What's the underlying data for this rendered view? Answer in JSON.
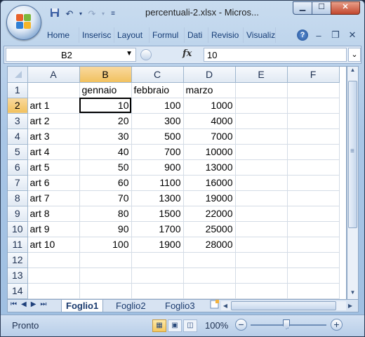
{
  "window": {
    "title": "percentuali-2.xlsx - Micros..."
  },
  "qat": {
    "save_icon": "save-icon",
    "undo_icon": "undo-icon",
    "redo_icon": "redo-icon",
    "customize_icon": "chevron-down-icon"
  },
  "ribbon": {
    "tabs": [
      "Home",
      "Inserisc",
      "Layout",
      "Formul",
      "Dati",
      "Revisio",
      "Visualiz"
    ]
  },
  "formula_bar": {
    "cell_ref": "B2",
    "fx_label": "fx",
    "content": "10"
  },
  "grid": {
    "columns": [
      "A",
      "B",
      "C",
      "D",
      "E",
      "F"
    ],
    "selected_column": "B",
    "selected_row": "2",
    "rows": [
      {
        "n": "1",
        "cells": [
          "",
          "gennaio",
          "febbraio",
          "marzo",
          "",
          ""
        ]
      },
      {
        "n": "2",
        "cells": [
          "art 1",
          "10",
          "100",
          "1000",
          "",
          ""
        ]
      },
      {
        "n": "3",
        "cells": [
          "art 2",
          "20",
          "300",
          "4000",
          "",
          ""
        ]
      },
      {
        "n": "4",
        "cells": [
          "art 3",
          "30",
          "500",
          "7000",
          "",
          ""
        ]
      },
      {
        "n": "5",
        "cells": [
          "art 4",
          "40",
          "700",
          "10000",
          "",
          ""
        ]
      },
      {
        "n": "6",
        "cells": [
          "art 5",
          "50",
          "900",
          "13000",
          "",
          ""
        ]
      },
      {
        "n": "7",
        "cells": [
          "art 6",
          "60",
          "1100",
          "16000",
          "",
          ""
        ]
      },
      {
        "n": "8",
        "cells": [
          "art 7",
          "70",
          "1300",
          "19000",
          "",
          ""
        ]
      },
      {
        "n": "9",
        "cells": [
          "art 8",
          "80",
          "1500",
          "22000",
          "",
          ""
        ]
      },
      {
        "n": "10",
        "cells": [
          "art 9",
          "90",
          "1700",
          "25000",
          "",
          ""
        ]
      },
      {
        "n": "11",
        "cells": [
          "art 10",
          "100",
          "1900",
          "28000",
          "",
          ""
        ]
      },
      {
        "n": "12",
        "cells": [
          "",
          "",
          "",
          "",
          "",
          ""
        ]
      },
      {
        "n": "13",
        "cells": [
          "",
          "",
          "",
          "",
          "",
          ""
        ]
      },
      {
        "n": "14",
        "cells": [
          "",
          "",
          "",
          "",
          "",
          ""
        ]
      }
    ]
  },
  "sheets": {
    "tabs": [
      "Foglio1",
      "Foglio2",
      "Foglio3"
    ],
    "active": "Foglio1"
  },
  "status": {
    "ready": "Pronto",
    "zoom": "100%"
  }
}
